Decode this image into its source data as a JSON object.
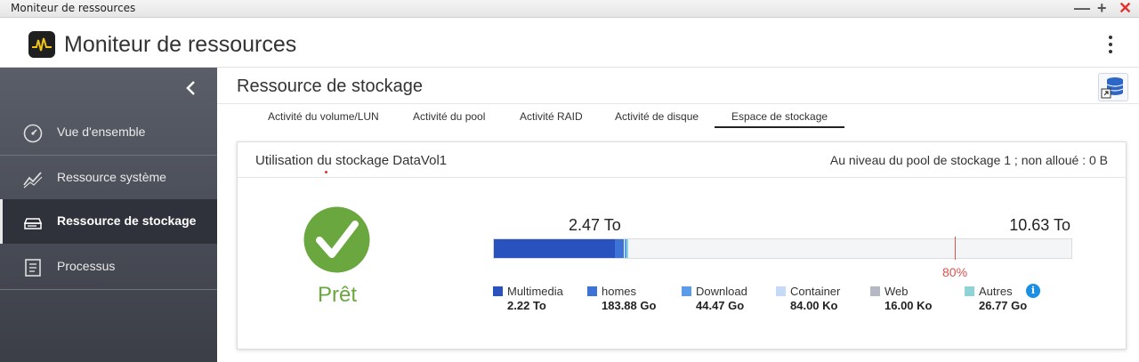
{
  "window": {
    "title": "Moniteur de ressources"
  },
  "app": {
    "title": "Moniteur de ressources"
  },
  "sidebar": {
    "items": [
      {
        "label": "Vue d'ensemble",
        "icon": "gauge-icon"
      },
      {
        "label": "Ressource système",
        "icon": "line-chart-icon"
      },
      {
        "label": "Ressource de stockage",
        "icon": "storage-icon",
        "active": true
      },
      {
        "label": "Processus",
        "icon": "list-document-icon"
      }
    ]
  },
  "main": {
    "page_title": "Ressource de stockage",
    "tabs": [
      {
        "label": "Activité du volume/LUN"
      },
      {
        "label": "Activité du pool"
      },
      {
        "label": "Activité RAID"
      },
      {
        "label": "Activité de disque"
      },
      {
        "label": "Espace de stockage",
        "active": true
      }
    ],
    "card": {
      "title": "Utilisation du stockage DataVol1",
      "pool_info": "Au niveau du pool de stockage 1 ; non alloué : 0 B",
      "status": "Prêt",
      "used": "2.47 To",
      "total": "10.63 To",
      "threshold_label": "80%",
      "threshold_fraction": 0.8,
      "legend": [
        {
          "name": "Multimedia",
          "value": "2.22 To",
          "color": "#2a52be"
        },
        {
          "name": "homes",
          "value": "183.88 Go",
          "color": "#3d72d6"
        },
        {
          "name": "Download",
          "value": "44.47 Go",
          "color": "#5a9bea"
        },
        {
          "name": "Container",
          "value": "84.00 Ko",
          "color": "#c4daf5"
        },
        {
          "name": "Web",
          "value": "16.00 Ko",
          "color": "#b4b9c4"
        },
        {
          "name": "Autres",
          "value": "26.77 Go",
          "color": "#8ed3d6"
        }
      ]
    }
  },
  "colors": {
    "sidebar": "#4a4e57",
    "ok_green": "#6aa83f",
    "threshold_red": "#d9534f",
    "info_blue": "#1a8fe3"
  }
}
